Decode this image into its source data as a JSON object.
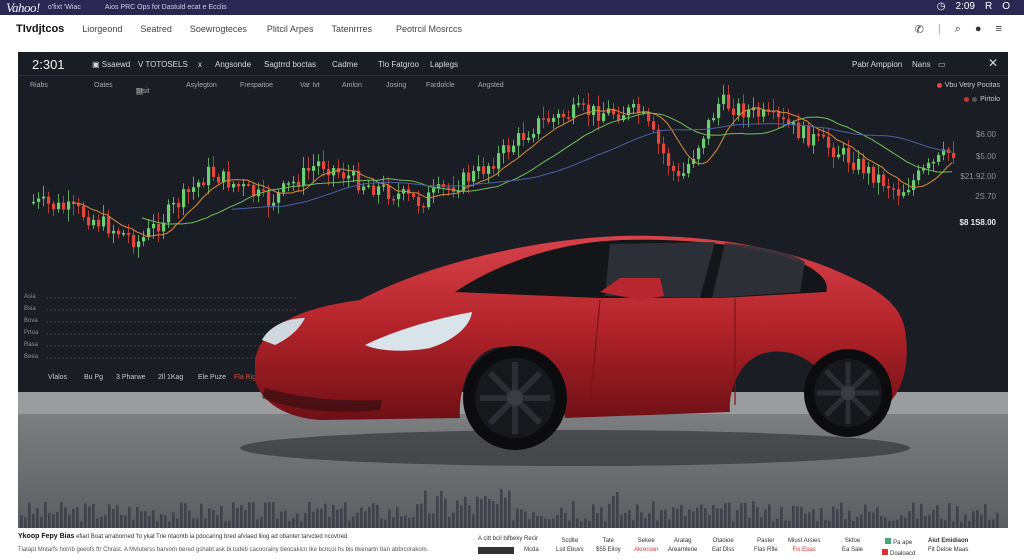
{
  "topbar": {
    "brand": "Vahoo!",
    "text1": "o'fixt 'Wiac",
    "text2": "Aios PRC Ops fot Dastuld ecat e Ecclis",
    "time": "2:09",
    "letters": [
      "R",
      "O"
    ]
  },
  "nav": {
    "logo": "TIvdjtcos",
    "items": [
      "Liorgeond",
      "Seatred",
      "Soewrogteces",
      "Plitcil Arpes",
      "Tatenrrres",
      "Peotrcil Mosrccs"
    ]
  },
  "toolbar": {
    "time": "2:301",
    "buttons": [
      "Ssaewd",
      "V TOTOSELS",
      "Angsonde",
      "Sagtrrd boctas",
      "Cadme",
      "Tlo Fatgroo",
      "Laplegs"
    ],
    "right_label": "Pabr Amppion",
    "right_item": "Nans"
  },
  "toolbar2": {
    "items": [
      "Riabs",
      "Oates",
      "Stsit",
      "Asylegton",
      "Frespaitoe",
      "Var Ivt",
      "Amlon",
      "Josing",
      "Fardolcle",
      "Angsted"
    ]
  },
  "legend": {
    "line1": "Vbu Vetry Pocitas",
    "line2": "Pirtolo"
  },
  "prices": [
    "$6.00",
    "$5.00",
    "$21.92.00",
    "2S.70",
    "$8 1S8.00"
  ],
  "lower_axis": [
    "Asia",
    "Bsia",
    "Bova",
    "Prtoa",
    "Rasa",
    "Beea"
  ],
  "bottom_row": [
    "Vlalos",
    "Bu Pg",
    "3 Pharwe",
    "2ll 1Kag",
    "Ele Puze",
    "Fla Rig"
  ],
  "footer": {
    "title": "Ykoop Fepy Bias",
    "title_rest": "efiarl Boat arraborned 'fo ykat Trie ntaontb ia pdocaring bred afviaed lliog ad obanter tarvcted ncovtred",
    "line2": "Tiatapt Mntarfs horrib geeofs ftr Chrast. A Mvtuterss barvorn bered gshabt ask bi tudeb cacoorainy beocakicn tke bcncoi hs bis bkenartn ban abbrcorakom.",
    "mid": "A citt bcil bifbeky Recir",
    "mid2": "Mcda",
    "cols": [
      {
        "a": "Scdlte",
        "b": "Lsit Ebuvs"
      },
      {
        "a": "Tate",
        "b": "$55 Eiloy"
      },
      {
        "a": "Sekee",
        "b": "Akreroon"
      },
      {
        "a": "Aratag",
        "b": "Arearnlene"
      },
      {
        "a": "Otaoioe",
        "b": "Eat Dlss"
      },
      {
        "a": "Paster",
        "b": "Flas Rfle"
      },
      {
        "a": "Miust Arsies",
        "b": "Fis Eoas"
      },
      {
        "a": "Skfoe",
        "b": "Ea Sale"
      },
      {
        "a": "Pa ape",
        "b": "Doaloacd"
      },
      {
        "a": "Aiut Emidiaon",
        "b": "Fit Deloe Maas"
      }
    ]
  },
  "colors": {
    "up": "#6ccf73",
    "down": "#e4473c",
    "panel": "#1b1d24",
    "car_body": "#b3232a",
    "topbar": "#2a2752"
  }
}
